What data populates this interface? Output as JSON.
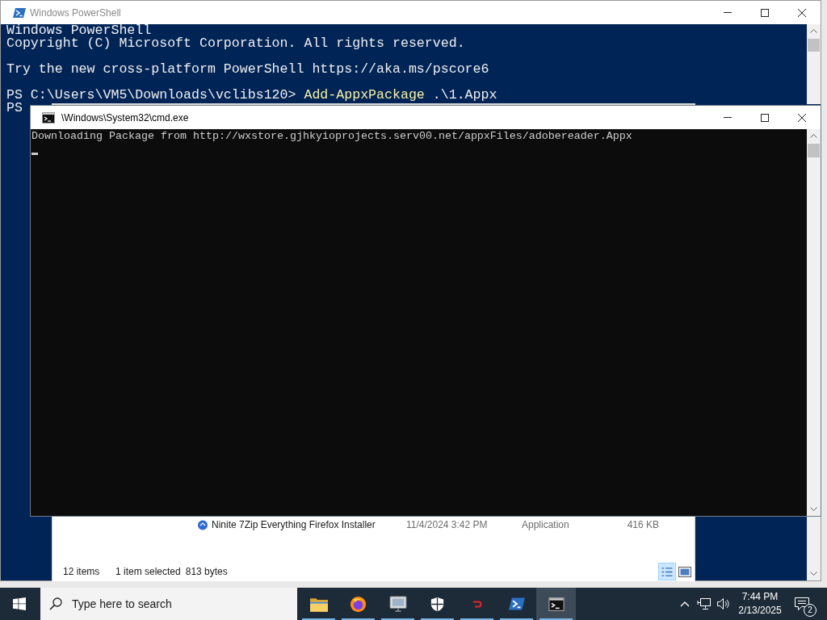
{
  "powershell_window": {
    "title": "Windows PowerShell",
    "active": false,
    "blocks": [
      {
        "lines": [
          {
            "segments": [
              {
                "kind": "output",
                "text": "Windows PowerShell"
              }
            ]
          },
          {
            "segments": [
              {
                "kind": "output",
                "text": "Copyright (C) Microsoft Corporation. All rights reserved."
              }
            ]
          }
        ]
      },
      {
        "lines": [
          {
            "segments": [
              {
                "kind": "output",
                "text": "Try the new cross-platform PowerShell https://aka.ms/pscore6"
              }
            ]
          }
        ]
      },
      {
        "lines": [
          {
            "segments": [
              {
                "kind": "prompt",
                "text": "PS C:\\Users\\VM5\\Downloads\\vclibs120> "
              },
              {
                "kind": "command",
                "text": "Add-AppxPackage"
              },
              {
                "kind": "argument",
                "text": " .\\1.Appx"
              }
            ]
          },
          {
            "segments": [
              {
                "kind": "prompt",
                "text": "PS"
              }
            ]
          }
        ]
      }
    ]
  },
  "cmd_window": {
    "title": "\\Windows\\System32\\cmd.exe",
    "active": true,
    "lines": [
      "Downloading Package from http://wxstore.gjhkyioprojects.serv00.net/appxFiles/adobereader.Appx"
    ],
    "cursor_visible": true
  },
  "explorer_window": {
    "file_rows": [
      {
        "name": "Ninite 7Zip Everything Firefox Installer",
        "date_modified": "11/4/2024 3:42 PM",
        "type": "Application",
        "size": "416 KB"
      }
    ],
    "status_bar": {
      "item_count": "12 items",
      "selection": "1 item selected",
      "selection_size": "813 bytes"
    },
    "view_buttons": [
      {
        "kind": "details",
        "selected": true
      },
      {
        "kind": "large_icons",
        "selected": false
      }
    ]
  },
  "taskbar": {
    "search": {
      "placeholder": "Type here to search"
    },
    "apps": [
      {
        "kind": "folder",
        "running": true,
        "active": false
      },
      {
        "kind": "browser",
        "running": true,
        "active": false
      },
      {
        "kind": "monitor",
        "running": true,
        "active": false
      },
      {
        "kind": "shield",
        "running": true,
        "active": false
      },
      {
        "kind": "hook",
        "running": true,
        "active": false
      },
      {
        "kind": "powershell",
        "running": true,
        "active": false
      },
      {
        "kind": "console",
        "running": true,
        "active": true
      }
    ],
    "tray": {
      "time": "7:44 PM",
      "date": "2/13/2025",
      "notification_count": "2"
    }
  }
}
